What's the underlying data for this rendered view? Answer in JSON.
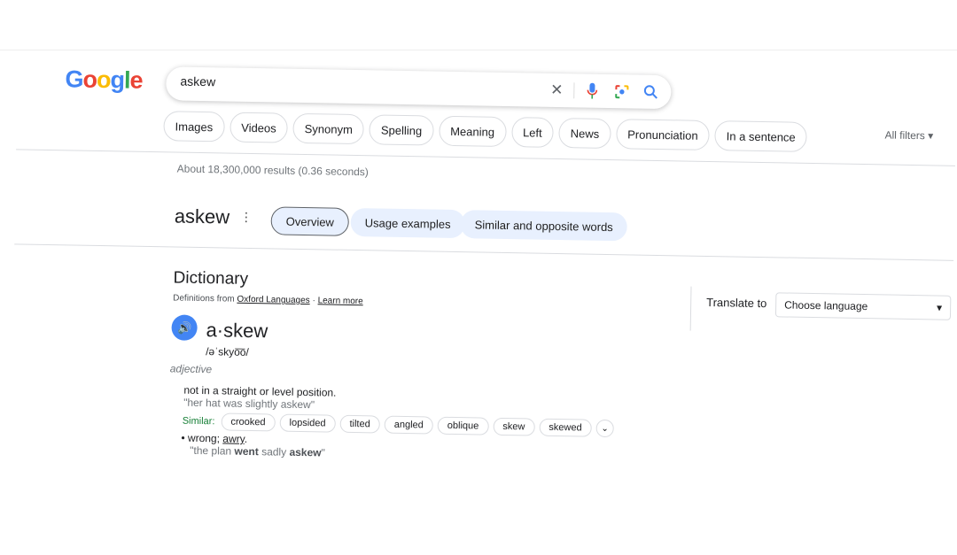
{
  "logo": {
    "text": "Google",
    "letters": [
      "G",
      "o",
      "o",
      "g",
      "l",
      "e"
    ],
    "colors": [
      "#4285f4",
      "#ea4335",
      "#fbbc05",
      "#4285f4",
      "#34a853",
      "#ea4335"
    ]
  },
  "search": {
    "query": "askew",
    "icons": [
      "close-icon",
      "microphone-icon",
      "lens-icon",
      "search-icon"
    ]
  },
  "chips": [
    "Images",
    "Videos",
    "Synonym",
    "Spelling",
    "Meaning",
    "Left",
    "News",
    "Pronunciation",
    "In a sentence"
  ],
  "all_filters": "All filters",
  "stats": "About 18,300,000 results (0.36 seconds)",
  "word_header": {
    "word": "askew",
    "tabs": [
      "Overview",
      "Usage examples",
      "Similar and opposite words"
    ]
  },
  "dictionary": {
    "title": "Dictionary",
    "source_prefix": "Definitions from",
    "source": "Oxford Languages",
    "separator": "·",
    "learn_more": "Learn more",
    "headword": "a·skew",
    "phonetic": "/əˈskyo͞o/",
    "part_of_speech": "adjective",
    "definition1": "not in a straight or level position.",
    "example1": "\"her hat was slightly askew\"",
    "similar_label": "Similar:",
    "similar": [
      "crooked",
      "lopsided",
      "tilted",
      "angled",
      "oblique",
      "skew",
      "skewed"
    ],
    "definition2_prefix": "wrong;",
    "definition2_link": "awry",
    "example2_parts": [
      "\"the plan ",
      "went",
      " sadly ",
      "askew",
      "\""
    ]
  },
  "translate": {
    "label": "Translate to",
    "select": "Choose language"
  },
  "colors": {
    "accent": "#4285f4",
    "similar": "#188038"
  }
}
